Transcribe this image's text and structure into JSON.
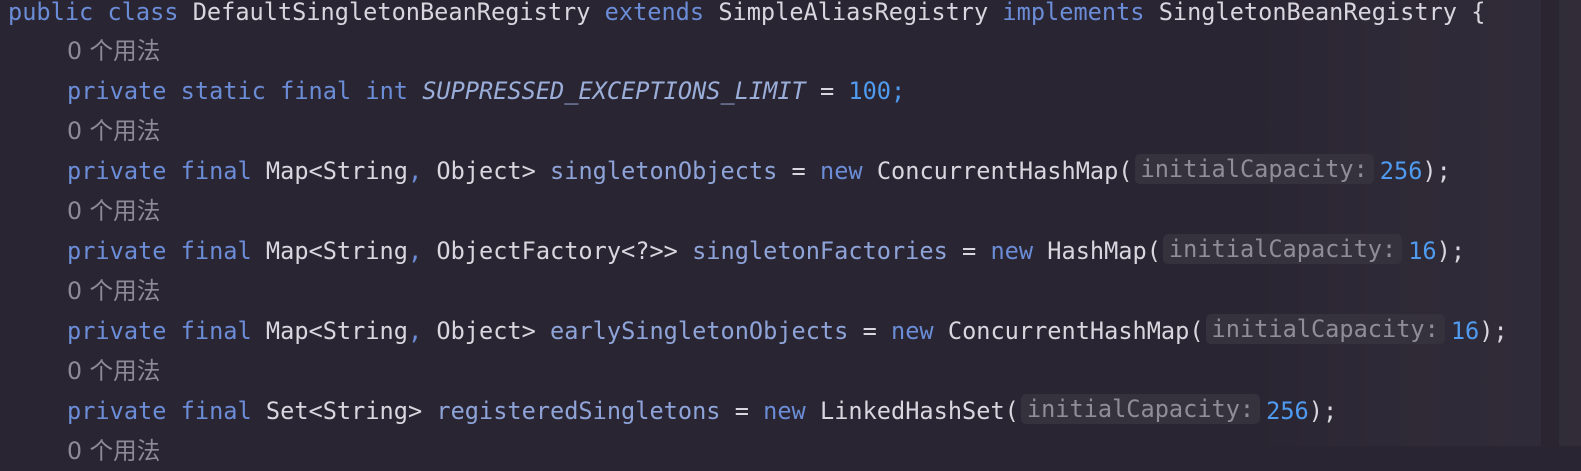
{
  "code": {
    "class_decl": {
      "public": "public",
      "class": "class",
      "name": "DefaultSingletonBeanRegistry",
      "extends": "extends",
      "parent": "SimpleAliasRegistry",
      "implements": "implements",
      "iface": "SingletonBeanRegistry",
      "brace": "{"
    },
    "usage_hint": "0 个用法",
    "lines": [
      {
        "mod1": "private",
        "mod2": "static",
        "mod3": "final",
        "type": "int",
        "name": "SUPPRESSED_EXCEPTIONS_LIMIT",
        "eq": "=",
        "value": "100",
        "end": ";"
      },
      {
        "mod1": "private",
        "mod2": "final",
        "type_a": "Map<String",
        "comma": ",",
        "type_b": "Object>",
        "name": "singletonObjects",
        "eq": "=",
        "new": "new",
        "ctor": "ConcurrentHashMap(",
        "hint": "initialCapacity:",
        "value": "256",
        "end": ");"
      },
      {
        "mod1": "private",
        "mod2": "final",
        "type_a": "Map<String",
        "comma": ",",
        "type_b": "ObjectFactory<?>>",
        "name": "singletonFactories",
        "eq": "=",
        "new": "new",
        "ctor": "HashMap(",
        "hint": "initialCapacity:",
        "value": "16",
        "end": ");"
      },
      {
        "mod1": "private",
        "mod2": "final",
        "type_a": "Map<String",
        "comma": ",",
        "type_b": "Object>",
        "name": "earlySingletonObjects",
        "eq": "=",
        "new": "new",
        "ctor": "ConcurrentHashMap(",
        "hint": "initialCapacity:",
        "value": "16",
        "end": ");"
      },
      {
        "mod1": "private",
        "mod2": "final",
        "type_a": "Set<String>",
        "name": "registeredSingletons",
        "eq": "=",
        "new": "new",
        "ctor": "LinkedHashSet(",
        "hint": "initialCapacity:",
        "value": "256",
        "end": ");"
      }
    ]
  },
  "colors": {
    "background": "#2a2532",
    "keyword": "#6b8cd6",
    "field": "#8ea4d9",
    "number": "#4f9bf0",
    "hint_bg": "#35313d"
  }
}
